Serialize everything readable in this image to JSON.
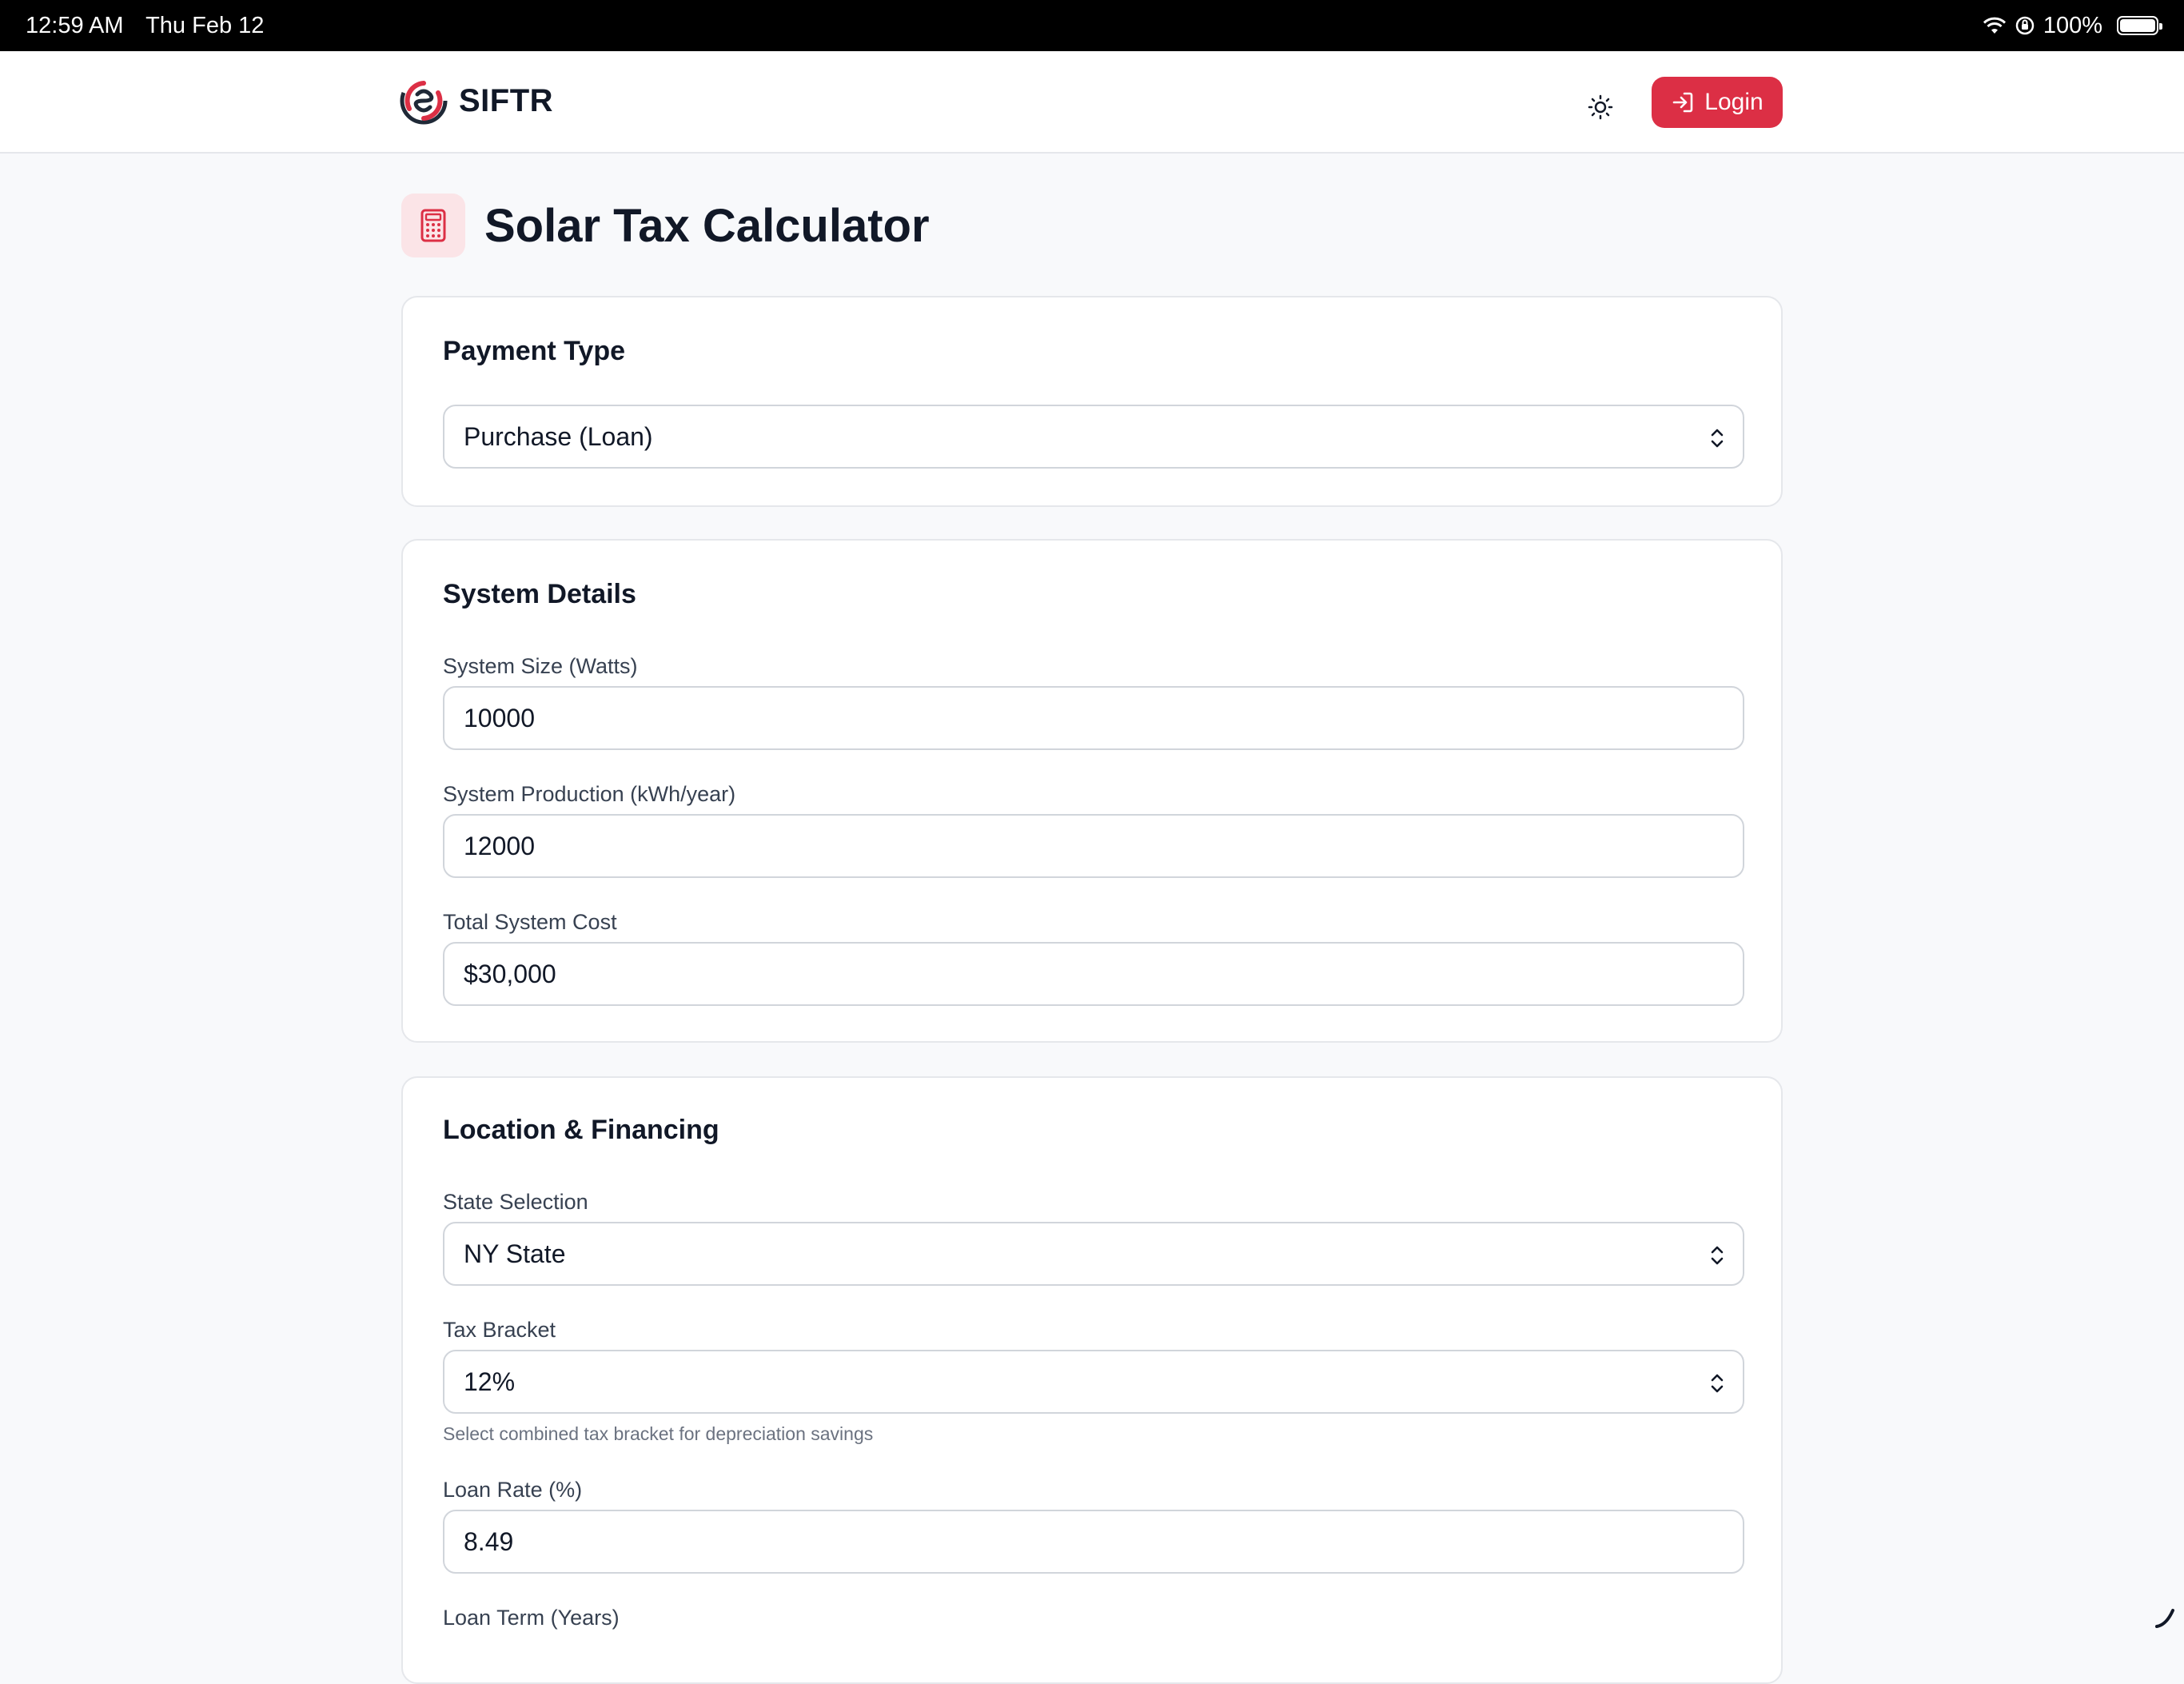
{
  "status_bar": {
    "time": "12:59 AM",
    "date": "Thu Feb 12",
    "battery": "100%"
  },
  "nav": {
    "brand": "SIFTR",
    "login_label": "Login",
    "colors": {
      "accent": "#dc2f45",
      "logo_dark": "#1f2937"
    }
  },
  "page": {
    "title": "Solar Tax Calculator"
  },
  "payment_card": {
    "title": "Payment Type",
    "payment_type": "Purchase (Loan)"
  },
  "system_card": {
    "title": "System Details",
    "size_label": "System Size (Watts)",
    "size_value": "10000",
    "production_label": "System Production (kWh/year)",
    "production_value": "12000",
    "cost_label": "Total System Cost",
    "cost_value": "$30,000"
  },
  "location_card": {
    "title": "Location & Financing",
    "state_label": "State Selection",
    "state_value": "NY State",
    "tax_label": "Tax Bracket",
    "tax_value": "12%",
    "tax_helper": "Select combined tax bracket for depreciation savings",
    "rate_label": "Loan Rate (%)",
    "rate_value": "8.49",
    "term_label": "Loan Term (Years)"
  },
  "icons": [
    "wifi-icon",
    "orientation-lock-icon",
    "battery-icon",
    "siftr-logo",
    "sun-icon",
    "login-icon",
    "calculator-icon",
    "chevron-updown-icon"
  ]
}
